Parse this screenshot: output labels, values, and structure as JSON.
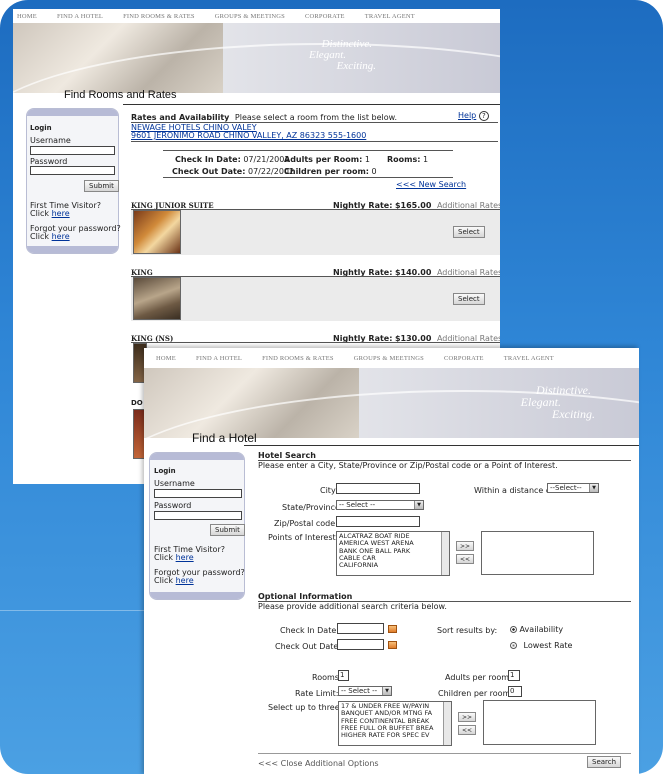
{
  "back_window": {
    "nav": [
      "HOME",
      "FIND A HOTEL",
      "FIND ROOMS & RATES",
      "GROUPS & MEETINGS",
      "CORPORATE",
      "TRAVEL AGENT"
    ],
    "tagline": [
      "Distinctive.",
      "Elegant.",
      "Exciting."
    ],
    "page_title": "Find Rooms and Rates",
    "login": {
      "title": "Login",
      "username_label": "Username",
      "password_label": "Password",
      "submit_label": "Submit",
      "first_time": "First Time Visitor?",
      "click": "Click",
      "here": "here",
      "forgot": "Forgot your password?"
    },
    "rates": {
      "heading": "Rates and Availability",
      "instruction": "Please select a room from the list below.",
      "help": "Help",
      "hotel_name": "NEWAGE HOTELS CHINO VALEY",
      "hotel_address": "9601 JERONIMO ROAD CHINO VALLEY, AZ 86323 555-1600",
      "check_in_label": "Check In Date:",
      "check_in_value": "07/21/2002",
      "check_out_label": "Check Out Date:",
      "check_out_value": "07/22/2002",
      "adults_label": "Adults per Room:",
      "adults_value": "1",
      "children_label": "Children per room:",
      "children_value": "0",
      "rooms_label": "Rooms:",
      "rooms_value": "1",
      "new_search": "<<< New Search",
      "nightly_label": "Nightly Rate:",
      "additional_rates": "Additional Rates>>",
      "select_label": "Select",
      "rooms": [
        {
          "name": "KING JUNIOR SUITE",
          "rate": "$165.00"
        },
        {
          "name": "KING",
          "rate": "$140.00"
        },
        {
          "name": "KING (NS)",
          "rate": "$130.00"
        }
      ],
      "partial_row": "DO"
    }
  },
  "front_window": {
    "nav": [
      "HOME",
      "FIND A HOTEL",
      "FIND ROOMS & RATES",
      "GROUPS & MEETINGS",
      "CORPORATE",
      "TRAVEL AGENT"
    ],
    "tagline": [
      "Distinctive.",
      "Elegant.",
      "Exciting."
    ],
    "page_title": "Find a Hotel",
    "login": {
      "title": "Login",
      "username_label": "Username",
      "password_label": "Password",
      "submit_label": "Submit",
      "first_time": "First Time Visitor?",
      "click": "Click",
      "here": "here",
      "forgot": "Forgot your password?"
    },
    "hotel_search": {
      "heading": "Hotel Search",
      "instruction": "Please enter a City, State/Province or Zip/Postal code or a Point of Interest.",
      "city_label": "City:",
      "city_value": "",
      "within_label": "Within a distance of",
      "within_value": "--Select--",
      "state_label": "State/Province:",
      "state_value": "-- Select --",
      "zip_label": "Zip/Postal code:",
      "zip_value": "",
      "poi_label": "Points of Interest:",
      "poi_options": [
        "ALCATRAZ BOAT RIDE",
        "AMERICA WEST ARENA",
        "BANK ONE BALL PARK",
        "CABLE CAR",
        "CALIFORNIA"
      ],
      "add_label": ">>",
      "remove_label": "<<"
    },
    "optional": {
      "heading": "Optional Information",
      "instruction": "Please provide additional search criteria below.",
      "check_in_label": "Check In Date:",
      "check_out_label": "Check Out Date:",
      "sort_label": "Sort results by:",
      "sort_availability": "Availability",
      "sort_lowest": "Lowest Rate",
      "rooms_label": "Rooms:",
      "rooms_value": "1",
      "adults_label": "Adults per room:",
      "adults_value": "1",
      "rate_limit_label": "Rate Limit:",
      "rate_limit_value": "-- Select --",
      "children_label": "Children per room:",
      "children_value": "0",
      "select_three_label": "Select up to three:",
      "amenity_options": [
        "17 & UNDER FREE W/PAYIN",
        "BANQUET AND/OR MTNG FA",
        "FREE CONTINENTAL BREAK",
        "FREE FULL OR BUFFET BREA",
        "HIGHER RATE FOR SPEC EV"
      ],
      "add_label": ">>",
      "remove_label": "<<",
      "close_options": "<<< Close Additional Options",
      "search_label": "Search"
    }
  }
}
